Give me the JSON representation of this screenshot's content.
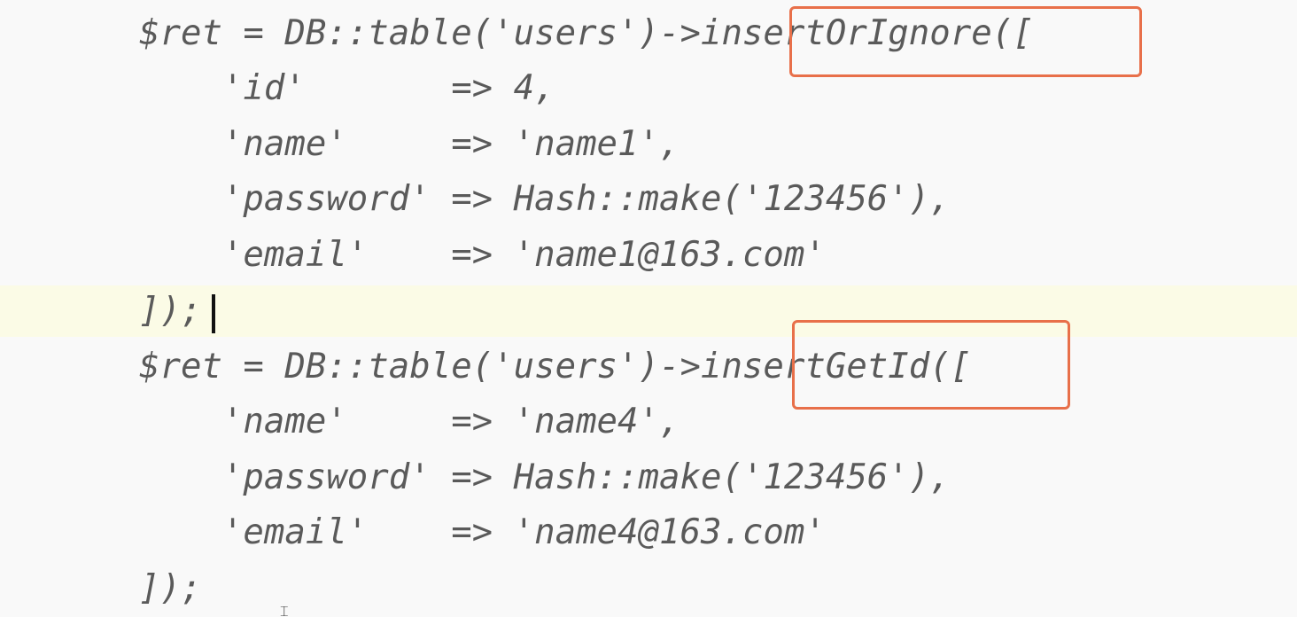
{
  "code_lines": [
    "$ret = DB::table('users')->insertOrIgnore([",
    "    'id'       => 4,",
    "    'name'     => 'name1',",
    "    'password' => Hash::make('123456'),",
    "    'email'    => 'name1@163.com'",
    "]);",
    "$ret = DB::table('users')->insertGetId([",
    "    'name'     => 'name4',",
    "    'password' => Hash::make('123456'),",
    "    'email'    => 'name4@163.com'",
    "]);"
  ],
  "highlights": [
    "insertOrIgnore",
    "insertGetId"
  ],
  "colors": {
    "highlight_border": "#e8704a",
    "current_line_bg": "#fbfbe6",
    "text": "#5a5a5a"
  },
  "mouse_cursor_glyph": "I"
}
